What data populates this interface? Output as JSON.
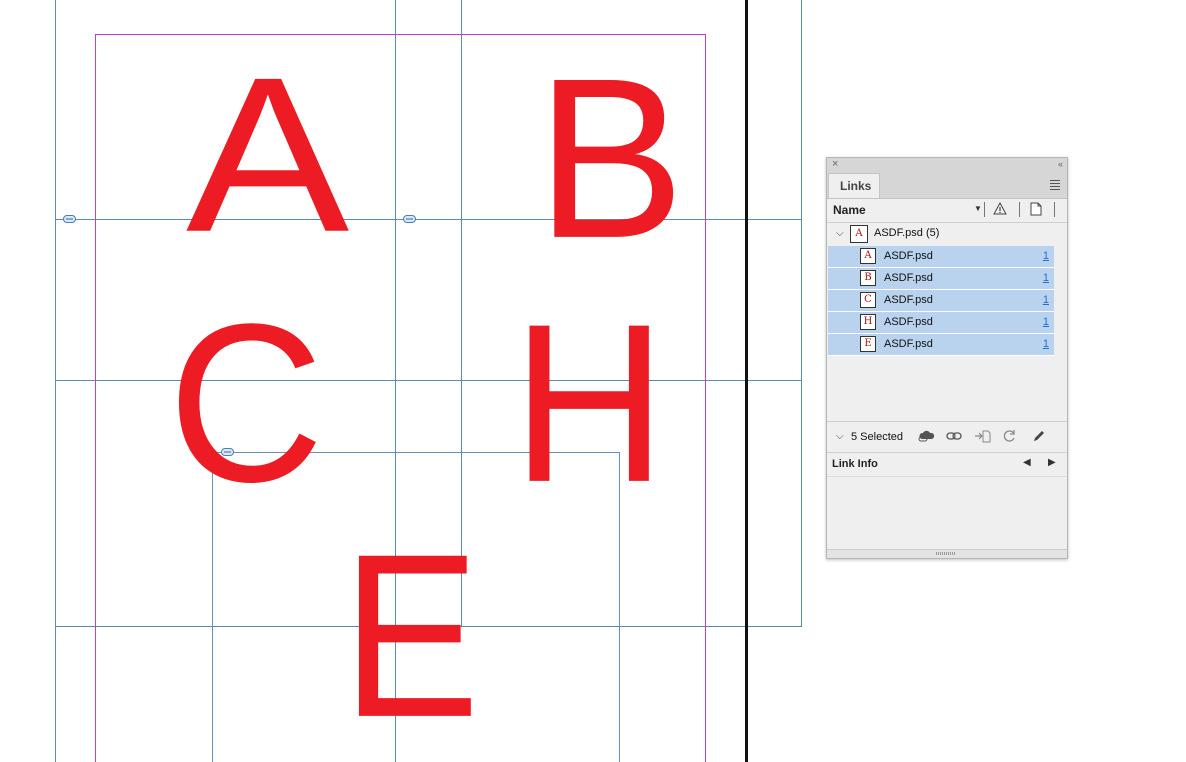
{
  "canvas": {
    "letters": [
      "A",
      "B",
      "C",
      "H",
      "E"
    ]
  },
  "panel": {
    "tab_label": "Links",
    "close_glyph": "×",
    "collapse_glyph": "‹‹",
    "column_name": "Name",
    "parent": {
      "thumb": "A",
      "label": "ASDF.psd (5)"
    },
    "items": [
      {
        "thumb": "A",
        "label": "ASDF.psd",
        "page": "1"
      },
      {
        "thumb": "B",
        "label": "ASDF.psd",
        "page": "1"
      },
      {
        "thumb": "C",
        "label": "ASDF.psd",
        "page": "1"
      },
      {
        "thumb": "H",
        "label": "ASDF.psd",
        "page": "1"
      },
      {
        "thumb": "E",
        "label": "ASDF.psd",
        "page": "1"
      }
    ],
    "status": {
      "selected_label": "5 Selected"
    },
    "link_info": {
      "title": "Link Info"
    },
    "icons": [
      "warning-icon",
      "page-icon",
      "cloud-link-icon",
      "relink-icon",
      "goto-link-icon",
      "update-link-icon",
      "edit-original-icon",
      "panel-menu-icon"
    ]
  },
  "colors": {
    "letter_red": "#ed1c24",
    "guide_blue": "#5b8bb0",
    "margin_magenta": "#c040c0",
    "selection_blue": "#b9d3ee",
    "link_blue": "#1f6fd0"
  }
}
